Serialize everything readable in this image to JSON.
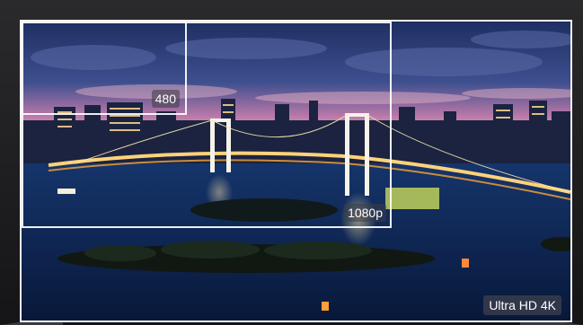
{
  "labels": {
    "res_480": "480",
    "res_1080": "1080p",
    "res_uhd": "Ultra HD 4K"
  },
  "colors": {
    "sky_top": "#2b3d74",
    "sky_horizon": "#d98bb0",
    "water": "#0c2a5a",
    "bridge_lights": "#ffd27a",
    "frame": "#ffffff"
  }
}
